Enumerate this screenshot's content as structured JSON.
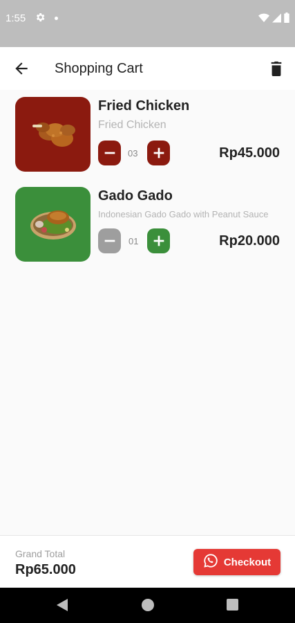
{
  "status_bar": {
    "time": "1:55",
    "icons": [
      "gear-icon",
      "notification-dot-icon",
      "wifi-icon",
      "signal-icon",
      "battery-icon"
    ]
  },
  "header": {
    "title": "Shopping Cart",
    "back_icon": "arrow-left-icon",
    "delete_icon": "trash-icon"
  },
  "cart": {
    "items": [
      {
        "name": "Fried Chicken",
        "description": "Fried Chicken",
        "quantity": "03",
        "price": "Rp45.000",
        "image": "fried-chicken-image",
        "tile_color": "#8b1a0f",
        "minus_color": "#8b1a0f",
        "plus_color": "#8b1a0f"
      },
      {
        "name": "Gado Gado",
        "description": "Indonesian Gado Gado with Peanut Sauce",
        "quantity": "01",
        "price": "Rp20.000",
        "image": "gado-gado-image",
        "tile_color": "#3b8f3b",
        "minus_color": "#9e9e9e",
        "plus_color": "#3b8f3b"
      }
    ]
  },
  "footer": {
    "grand_total_label": "Grand Total",
    "grand_total_value": "Rp65.000",
    "checkout_label": "Checkout",
    "checkout_icon": "whatsapp-icon",
    "checkout_color": "#e53935"
  },
  "nav_bar": {
    "icons": [
      "nav-back-icon",
      "nav-home-icon",
      "nav-recents-icon"
    ]
  }
}
